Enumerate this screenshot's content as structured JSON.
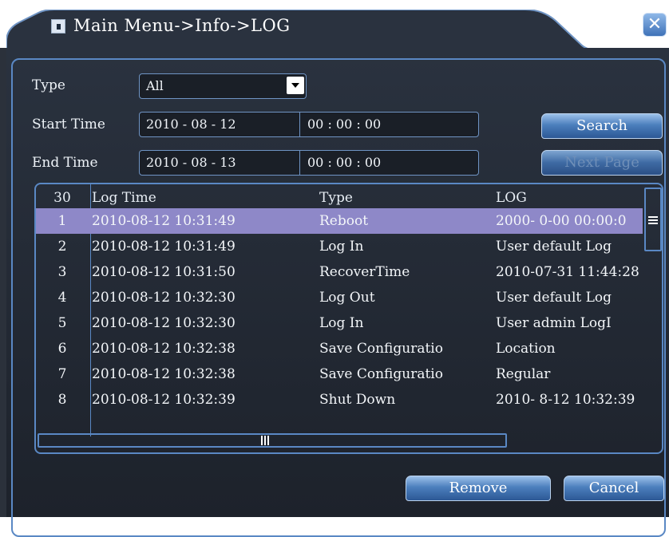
{
  "window": {
    "title": "Main Menu->Info->LOG",
    "icons": {
      "window": "monitor-icon",
      "close": "close-icon",
      "close_glyph": "✕"
    }
  },
  "filters": {
    "type_label": "Type",
    "type_value": "All",
    "start_label": "Start Time",
    "start_date": "2010 - 08 - 12",
    "start_time": "00 : 00 : 00",
    "end_label": "End Time",
    "end_date": "2010 - 08 - 13",
    "end_time": "00 : 00 : 00"
  },
  "buttons": {
    "search": "Search",
    "next_page": "Next Page",
    "remove": "Remove",
    "cancel": "Cancel"
  },
  "table": {
    "headers": {
      "num": "30",
      "time": "Log Time",
      "type": "Type",
      "log": "LOG"
    },
    "rows": [
      {
        "num": "1",
        "time": "2010-08-12 10:31:49",
        "type": "Reboot",
        "log": "2000- 0-00 00:00:0"
      },
      {
        "num": "2",
        "time": "2010-08-12 10:31:49",
        "type": "Log In",
        "log": "User default Log"
      },
      {
        "num": "3",
        "time": "2010-08-12 10:31:50",
        "type": "RecoverTime",
        "log": "2010-07-31 11:44:28"
      },
      {
        "num": "4",
        "time": "2010-08-12 10:32:30",
        "type": "Log Out",
        "log": "User default Log"
      },
      {
        "num": "5",
        "time": "2010-08-12 10:32:30",
        "type": "Log In",
        "log": "User admin LogI"
      },
      {
        "num": "6",
        "time": "2010-08-12 10:32:38",
        "type": "Save Configuratio",
        "log": "Location"
      },
      {
        "num": "7",
        "time": "2010-08-12 10:32:38",
        "type": "Save Configuratio",
        "log": "Regular"
      },
      {
        "num": "8",
        "time": "2010-08-12 10:32:39",
        "type": "Shut Down",
        "log": "2010- 8-12 10:32:39"
      }
    ]
  },
  "colors": {
    "accent": "#5a88c4",
    "selected_row": "#8e88c8",
    "panel": "#222833"
  }
}
